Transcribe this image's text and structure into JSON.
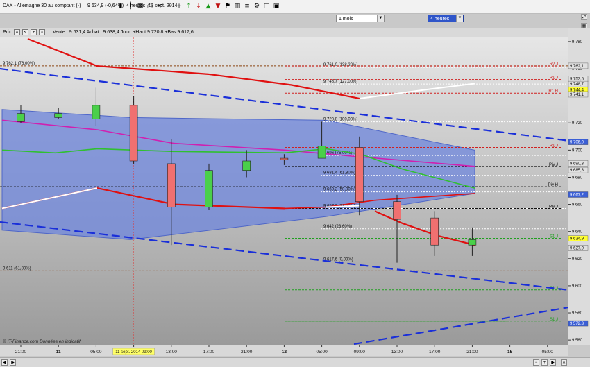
{
  "window": {
    "title": "DAX - Allemagne 30 au comptant (-)",
    "quote": "9 634,9 (-0,64%)",
    "period": "4 heures",
    "date": "12 sept. 2014"
  },
  "toolbar_icons": [
    "bar-chart-icon",
    "candles-icon",
    "table-icon",
    "print-icon",
    "scissors-icon",
    "minus-icon",
    "plus-icon",
    "up-arrow-icon",
    "down-arrow-icon",
    "up-arrow-green-icon",
    "down-arrow-red-icon",
    "flag-icon",
    "bar-chart-2-icon",
    "lines-icon",
    "settings-icon",
    "blank-icon",
    "layout-icon"
  ],
  "selectors": {
    "range": "1 mois",
    "interval": "4 heures"
  },
  "info_line": {
    "prefix": "Prix",
    "text": "Vente : 9 631,4 Achat : 9 638,4 Jour :+Haut 9 720,8 +Bas 9 617,6"
  },
  "watermark": "© IT-Finance.com  Données en indicatif",
  "chart_data": {
    "type": "candlestick",
    "price_axis": {
      "ylim": [
        9557,
        9782
      ],
      "ticks": [
        "9 780",
        "9 760",
        "9 740",
        "9 720",
        "9 700",
        "9 680",
        "9 660",
        "9 640",
        "9 620",
        "9 600",
        "9 580",
        "9 560"
      ]
    },
    "time_axis": {
      "ticks": [
        "21:00",
        "11",
        "05:00",
        "11 sept. 2014 09:00",
        "13:00",
        "17:00",
        "21:00",
        "12",
        "05:00",
        "09:00",
        "13:00",
        "17:00",
        "21:00",
        "15",
        "05:00"
      ],
      "bold": [
        "11",
        "12",
        "15"
      ],
      "highlight": "11 sept. 2014 09:00"
    },
    "candles": [
      {
        "o": 9721,
        "h": 9733,
        "l": 9720,
        "c": 9727
      },
      {
        "o": 9724,
        "h": 9731,
        "l": 9723,
        "c": 9727
      },
      {
        "o": 9723,
        "h": 9746,
        "l": 9718,
        "c": 9733
      },
      {
        "o": 9733,
        "h": 9740,
        "l": 9690,
        "c": 9692
      },
      {
        "o": 9690,
        "h": 9708,
        "l": 9630,
        "c": 9658
      },
      {
        "o": 9658,
        "h": 9690,
        "l": 9656,
        "c": 9685
      },
      {
        "o": 9685,
        "h": 9700,
        "l": 9680,
        "c": 9692
      },
      {
        "o": 9694,
        "h": 9697,
        "l": 9689,
        "c": 9693
      },
      {
        "o": 9694,
        "h": 9721,
        "l": 9694,
        "c": 9703
      },
      {
        "o": 9702,
        "h": 9710,
        "l": 9652,
        "c": 9662
      },
      {
        "o": 9662,
        "h": 9667,
        "l": 9617,
        "c": 9649
      },
      {
        "o": 9650,
        "h": 9655,
        "l": 9622,
        "c": 9630
      },
      {
        "o": 9630,
        "h": 9643,
        "l": 9622,
        "c": 9634
      }
    ],
    "fib_levels": [
      {
        "label": "9 761,0 (138,20%)",
        "value": 9761
      },
      {
        "label": "9 748,7 (127,00%)",
        "value": 9748.7
      },
      {
        "label": "9 720,8 (100,00%)",
        "value": 9720.8
      },
      {
        "label": "9 696 (76,00%)",
        "value": 9696
      },
      {
        "label": "9 681,4 (61,80%)",
        "value": 9681.4
      },
      {
        "label": "9 669,2 (50,00%)",
        "value": 9669.2
      },
      {
        "label": "9 657,0 (38,20%)",
        "value": 9657
      },
      {
        "label": "9 642 (23,60%)",
        "value": 9642
      },
      {
        "label": "9 617,6 (0,00%)",
        "value": 9617.6
      }
    ],
    "side_labels": [
      {
        "label": "9 762,1 (76,00%)",
        "value": 9762.1
      },
      {
        "label": "9 611 (61,80%)",
        "value": 9611
      }
    ],
    "pivots": [
      {
        "label": "R2 J",
        "value": 9762
      },
      {
        "label": "R1 J",
        "value": 9752
      },
      {
        "label": "R1 H",
        "value": 9742
      },
      {
        "label": "R1 J",
        "value": 9702
      },
      {
        "label": "Piv J",
        "value": 9688
      },
      {
        "label": "Piv H",
        "value": 9673
      },
      {
        "label": "Piv J",
        "value": 9657
      },
      {
        "label": "S1 J",
        "value": 9635
      },
      {
        "label": "S1 J",
        "value": 9597
      },
      {
        "label": "S1 J",
        "value": 9574
      }
    ],
    "axis_tags": [
      {
        "text": "9 762,1",
        "value": 9762.1,
        "color": "#e0e0e0"
      },
      {
        "text": "9 752,5",
        "value": 9752.5,
        "color": "#e0e0e0"
      },
      {
        "text": "9 748,7",
        "value": 9748.7,
        "color": "#e0e0e0"
      },
      {
        "text": "9 744,4",
        "value": 9744.4,
        "color": "#ffff33"
      },
      {
        "text": "9 741,1",
        "value": 9741.1,
        "color": "#e0e0e0"
      },
      {
        "text": "9 706,0",
        "value": 9706,
        "color": "#3b5fd6"
      },
      {
        "text": "9 690,3",
        "value": 9690.3,
        "color": "#e0e0e0"
      },
      {
        "text": "9 685,3",
        "value": 9685.3,
        "color": "#e0e0e0"
      },
      {
        "text": "9 667,2",
        "value": 9667.2,
        "color": "#3b5fd6"
      },
      {
        "text": "9 634,9",
        "value": 9634.9,
        "color": "#ffff33"
      },
      {
        "text": "9 627,9",
        "value": 9627.9,
        "color": "#e0e0e0"
      },
      {
        "text": "9 572,3",
        "value": 9572.3,
        "color": "#3b5fd6"
      }
    ],
    "colors": {
      "up": "#4ad04a",
      "down": "#f07070",
      "channel_fill": "#6e86dc",
      "trend_dash": "#1a2fd9",
      "ma_red": "#e01010",
      "ma_green": "#30c030",
      "ma_magenta": "#d020b0",
      "ma_white": "#ffffff"
    }
  }
}
